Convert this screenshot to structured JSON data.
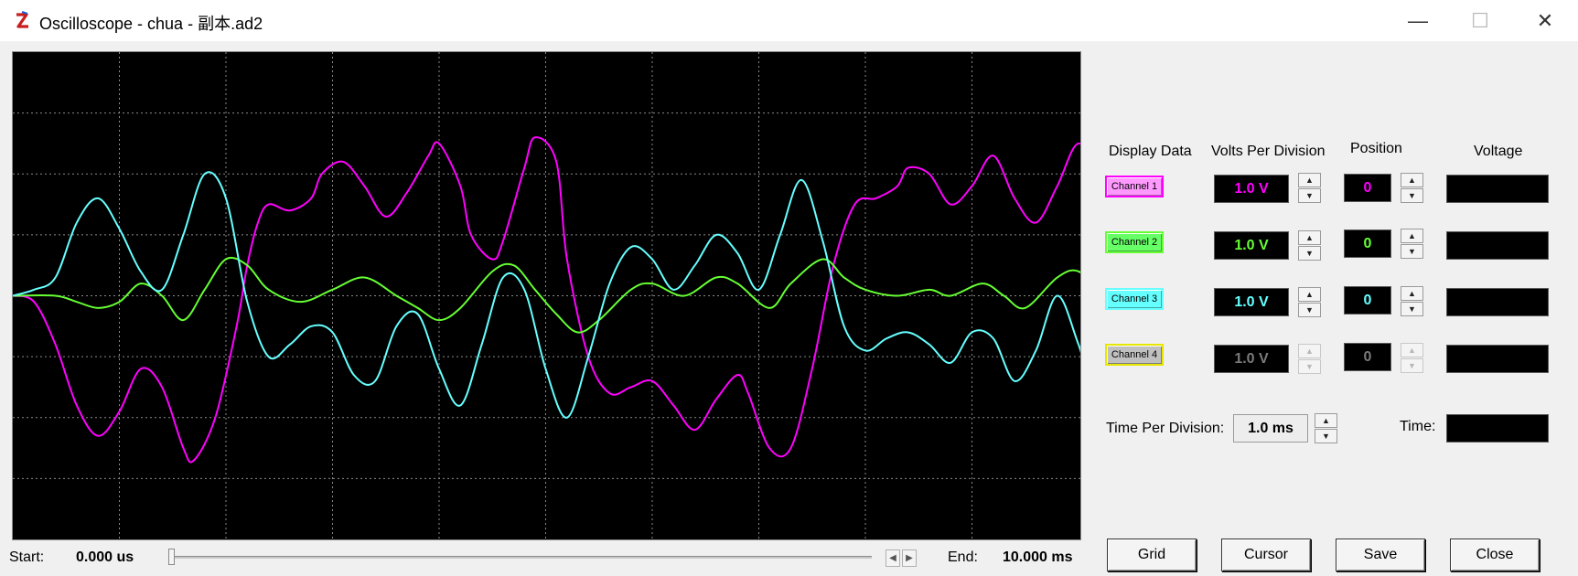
{
  "window": {
    "title": "Oscilloscope - chua - 副本.ad2",
    "minimize_icon": "minimize-icon",
    "maximize_icon": "maximize-icon",
    "close_icon": "close-icon"
  },
  "headers": {
    "display_data": "Display Data",
    "volts_per_division": "Volts Per Division",
    "position": "Position",
    "voltage": "Voltage"
  },
  "channels": [
    {
      "label": "Channel 1",
      "volts": "1.0 V",
      "position": "0",
      "color": "#ff00ff",
      "button_bg": "#ff99ff",
      "enabled": true
    },
    {
      "label": "Channel 2",
      "volts": "1.0 V",
      "position": "0",
      "color": "#66ff33",
      "button_bg": "#66ff66",
      "enabled": true
    },
    {
      "label": "Channel 3",
      "volts": "1.0 V",
      "position": "0",
      "color": "#66ffff",
      "button_bg": "#66ffff",
      "enabled": true
    },
    {
      "label": "Channel 4",
      "volts": "1.0 V",
      "position": "0",
      "color": "#7a7a7a",
      "button_bg": "#c0c0c0",
      "enabled": false
    }
  ],
  "time_per_division": {
    "label": "Time Per Division:",
    "value": "1.0 ms"
  },
  "time": {
    "label": "Time:"
  },
  "range": {
    "start_label": "Start:",
    "start_value": "0.000 us",
    "end_label": "End:",
    "end_value": "10.000 ms",
    "slider_position": 0
  },
  "buttons": {
    "grid": "Grid",
    "cursor": "Cursor",
    "save": "Save",
    "close": "Close"
  },
  "chart_data": {
    "type": "line",
    "grid_divisions": {
      "x": 10,
      "y": 8
    },
    "grid": true,
    "x_range_ms": [
      0,
      10
    ],
    "y_range_div": [
      -4,
      4
    ],
    "series": [
      {
        "channel": "Channel 1",
        "color": "#ff00ff",
        "points": [
          [
            0,
            0
          ],
          [
            0.2,
            -0.1
          ],
          [
            0.4,
            -0.8
          ],
          [
            0.6,
            -1.8
          ],
          [
            0.8,
            -2.3
          ],
          [
            1.0,
            -1.9
          ],
          [
            1.2,
            -1.2
          ],
          [
            1.4,
            -1.5
          ],
          [
            1.6,
            -2.5
          ],
          [
            1.7,
            -2.7
          ],
          [
            1.9,
            -2.0
          ],
          [
            2.1,
            -0.5
          ],
          [
            2.2,
            0.5
          ],
          [
            2.3,
            1.2
          ],
          [
            2.4,
            1.5
          ],
          [
            2.6,
            1.4
          ],
          [
            2.8,
            1.6
          ],
          [
            2.9,
            2.0
          ],
          [
            3.1,
            2.2
          ],
          [
            3.3,
            1.8
          ],
          [
            3.5,
            1.3
          ],
          [
            3.7,
            1.7
          ],
          [
            3.9,
            2.3
          ],
          [
            4.0,
            2.5
          ],
          [
            4.2,
            1.8
          ],
          [
            4.3,
            1.0
          ],
          [
            4.5,
            0.6
          ],
          [
            4.6,
            0.9
          ],
          [
            4.8,
            2.1
          ],
          [
            4.9,
            2.6
          ],
          [
            5.1,
            2.2
          ],
          [
            5.2,
            0.6
          ],
          [
            5.4,
            -1.0
          ],
          [
            5.6,
            -1.6
          ],
          [
            5.8,
            -1.5
          ],
          [
            6.0,
            -1.4
          ],
          [
            6.2,
            -1.8
          ],
          [
            6.4,
            -2.2
          ],
          [
            6.6,
            -1.7
          ],
          [
            6.8,
            -1.3
          ],
          [
            6.9,
            -1.6
          ],
          [
            7.1,
            -2.5
          ],
          [
            7.3,
            -2.5
          ],
          [
            7.5,
            -1.2
          ],
          [
            7.7,
            0.5
          ],
          [
            7.9,
            1.5
          ],
          [
            8.1,
            1.6
          ],
          [
            8.3,
            1.8
          ],
          [
            8.4,
            2.1
          ],
          [
            8.6,
            2.0
          ],
          [
            8.8,
            1.5
          ],
          [
            9.0,
            1.8
          ],
          [
            9.2,
            2.3
          ],
          [
            9.4,
            1.6
          ],
          [
            9.6,
            1.2
          ],
          [
            9.8,
            1.8
          ],
          [
            10.0,
            2.5
          ],
          [
            10.2,
            1.9
          ],
          [
            10.4,
            0.8
          ],
          [
            10.6,
            0.6
          ]
        ]
      },
      {
        "channel": "Channel 2",
        "color": "#66ff33",
        "points": [
          [
            0,
            0
          ],
          [
            0.4,
            0.0
          ],
          [
            0.6,
            -0.1
          ],
          [
            0.8,
            -0.2
          ],
          [
            1.0,
            -0.1
          ],
          [
            1.2,
            0.2
          ],
          [
            1.4,
            0.0
          ],
          [
            1.6,
            -0.4
          ],
          [
            1.8,
            0.1
          ],
          [
            2.0,
            0.6
          ],
          [
            2.2,
            0.5
          ],
          [
            2.4,
            0.1
          ],
          [
            2.7,
            -0.1
          ],
          [
            3.0,
            0.1
          ],
          [
            3.3,
            0.3
          ],
          [
            3.6,
            0.0
          ],
          [
            3.8,
            -0.2
          ],
          [
            4.0,
            -0.4
          ],
          [
            4.2,
            -0.2
          ],
          [
            4.5,
            0.4
          ],
          [
            4.7,
            0.5
          ],
          [
            4.9,
            0.1
          ],
          [
            5.1,
            -0.3
          ],
          [
            5.3,
            -0.6
          ],
          [
            5.5,
            -0.4
          ],
          [
            5.8,
            0.1
          ],
          [
            6.0,
            0.2
          ],
          [
            6.3,
            0.0
          ],
          [
            6.6,
            0.3
          ],
          [
            6.8,
            0.2
          ],
          [
            7.1,
            -0.2
          ],
          [
            7.3,
            0.2
          ],
          [
            7.6,
            0.6
          ],
          [
            7.8,
            0.3
          ],
          [
            8.0,
            0.1
          ],
          [
            8.3,
            0.0
          ],
          [
            8.6,
            0.1
          ],
          [
            8.8,
            0.0
          ],
          [
            9.1,
            0.2
          ],
          [
            9.3,
            0.0
          ],
          [
            9.5,
            -0.2
          ],
          [
            9.8,
            0.3
          ],
          [
            10.0,
            0.4
          ],
          [
            10.2,
            0.0
          ],
          [
            10.4,
            -0.4
          ],
          [
            10.6,
            0.1
          ]
        ]
      },
      {
        "channel": "Channel 3",
        "color": "#66ffff",
        "points": [
          [
            0,
            0
          ],
          [
            0.2,
            0.1
          ],
          [
            0.4,
            0.3
          ],
          [
            0.6,
            1.2
          ],
          [
            0.8,
            1.6
          ],
          [
            1.0,
            1.1
          ],
          [
            1.2,
            0.4
          ],
          [
            1.4,
            0.1
          ],
          [
            1.6,
            1.0
          ],
          [
            1.8,
            2.0
          ],
          [
            2.0,
            1.6
          ],
          [
            2.2,
            -0.1
          ],
          [
            2.4,
            -1.0
          ],
          [
            2.6,
            -0.8
          ],
          [
            2.8,
            -0.5
          ],
          [
            3.0,
            -0.6
          ],
          [
            3.2,
            -1.3
          ],
          [
            3.4,
            -1.4
          ],
          [
            3.6,
            -0.5
          ],
          [
            3.8,
            -0.3
          ],
          [
            4.0,
            -1.2
          ],
          [
            4.2,
            -1.8
          ],
          [
            4.4,
            -0.8
          ],
          [
            4.6,
            0.3
          ],
          [
            4.8,
            0.1
          ],
          [
            5.0,
            -1.2
          ],
          [
            5.2,
            -2.0
          ],
          [
            5.4,
            -1.0
          ],
          [
            5.6,
            0.2
          ],
          [
            5.8,
            0.8
          ],
          [
            6.0,
            0.6
          ],
          [
            6.2,
            0.1
          ],
          [
            6.4,
            0.5
          ],
          [
            6.6,
            1.0
          ],
          [
            6.8,
            0.7
          ],
          [
            7.0,
            0.1
          ],
          [
            7.2,
            1.0
          ],
          [
            7.4,
            1.9
          ],
          [
            7.6,
            0.9
          ],
          [
            7.8,
            -0.5
          ],
          [
            8.0,
            -0.9
          ],
          [
            8.2,
            -0.7
          ],
          [
            8.4,
            -0.6
          ],
          [
            8.6,
            -0.8
          ],
          [
            8.8,
            -1.1
          ],
          [
            9.0,
            -0.6
          ],
          [
            9.2,
            -0.7
          ],
          [
            9.4,
            -1.4
          ],
          [
            9.6,
            -0.9
          ],
          [
            9.8,
            0.0
          ],
          [
            10.0,
            -0.8
          ],
          [
            10.2,
            -1.8
          ],
          [
            10.4,
            -0.6
          ],
          [
            10.6,
            0.5
          ]
        ]
      }
    ]
  }
}
